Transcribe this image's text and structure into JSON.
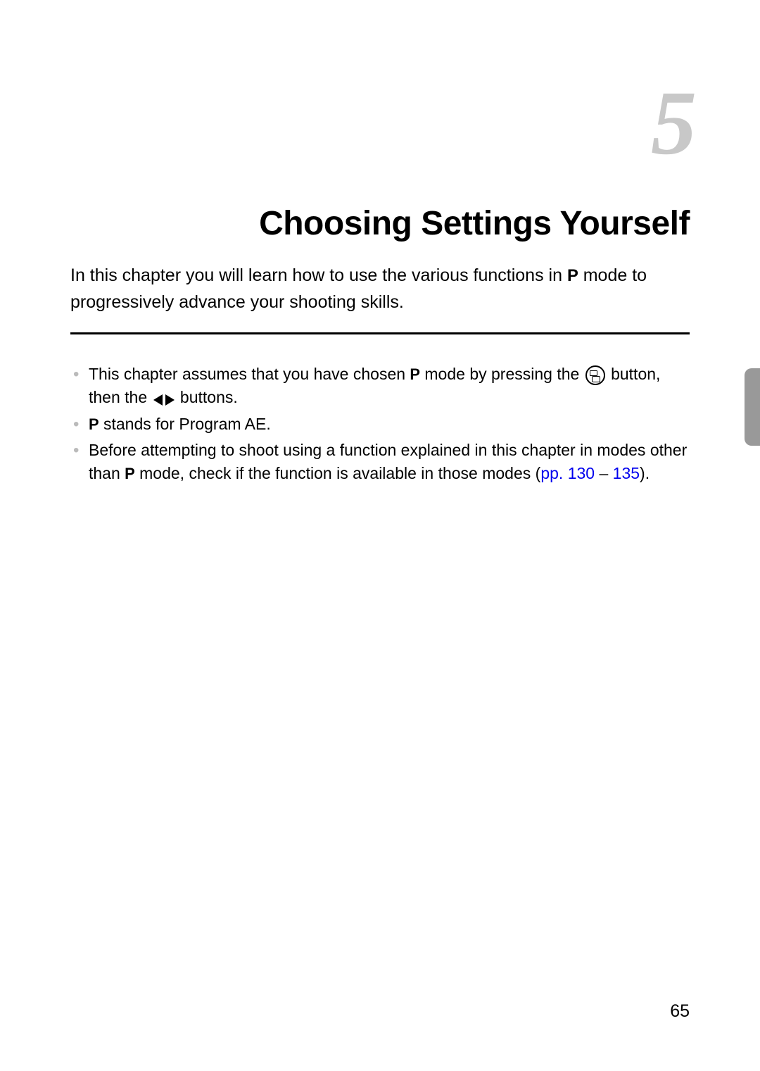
{
  "chapter": {
    "number": "5",
    "title": "Choosing Settings Yourself",
    "intro_part1": "In this chapter you will learn how to use the various functions in ",
    "intro_part2": " mode to progressively advance your shooting skills."
  },
  "bullets": {
    "b1_part1": "This chapter assumes that you have chosen ",
    "b1_part2": " mode by pressing the ",
    "b1_part3": " button, then the ",
    "b1_part4": " buttons.",
    "b2_part1": " stands for Program AE.",
    "b3_part1": "Before attempting to shoot using a function explained in this chapter in modes other than ",
    "b3_part2": " mode, check if the function is available in those modes ",
    "b3_link1": "(",
    "b3_link_pp": "pp. 130",
    "b3_link_dash": " – ",
    "b3_link_135": "135",
    "b3_link_close": ").",
    "p_symbol": "P"
  },
  "page_number": "65"
}
